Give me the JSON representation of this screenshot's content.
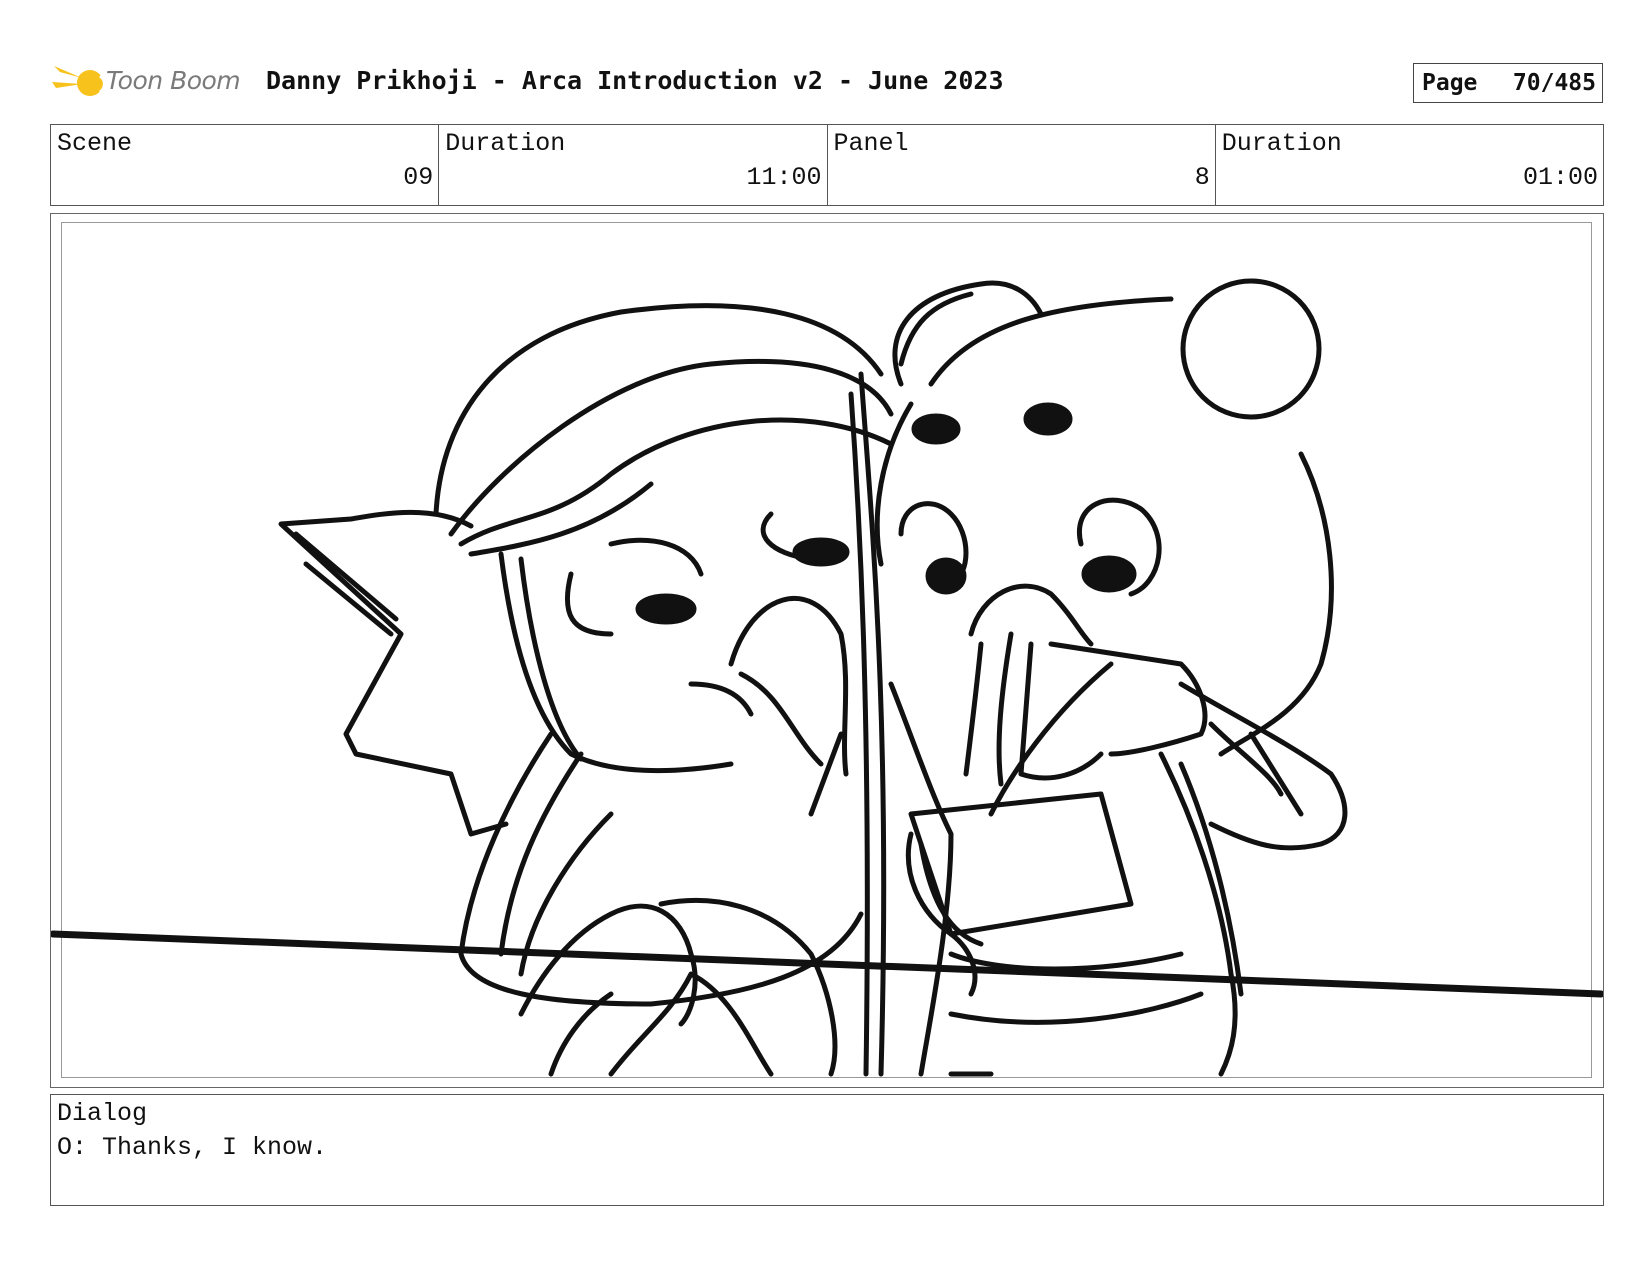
{
  "header": {
    "logo_text": "Toon Boom",
    "title": "Danny Prikhoji - Arca Introduction v2 - June 2023",
    "page_label": "Page",
    "page_value": "70/485"
  },
  "info": {
    "scene_label": "Scene",
    "scene_value": "09",
    "scene_duration_label": "Duration",
    "scene_duration_value": "11:00",
    "panel_label": "Panel",
    "panel_value": "8",
    "panel_duration_label": "Duration",
    "panel_duration_value": "01:00"
  },
  "dialog": {
    "label": "Dialog",
    "text": "O: Thanks, I know."
  },
  "colors": {
    "logo_yellow": "#f6c21b",
    "logo_text": "#7a7a7a",
    "ink": "#111111"
  }
}
